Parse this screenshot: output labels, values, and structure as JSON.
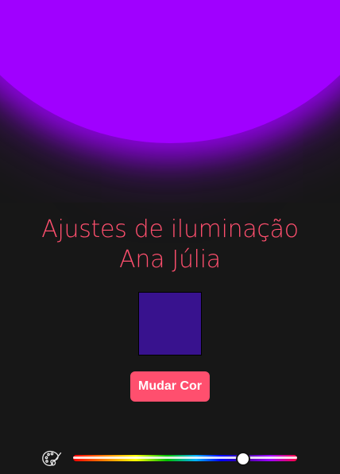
{
  "heading": {
    "line1": "Ajustes de iluminação",
    "line2": "Ana Júlia"
  },
  "preview": {
    "color": "#38128e"
  },
  "button": {
    "label": "Mudar Cor"
  },
  "light": {
    "color": "#a000ff"
  },
  "hue_slider": {
    "value_fraction": 0.76
  },
  "icons": {
    "palette": "palette-icon"
  }
}
